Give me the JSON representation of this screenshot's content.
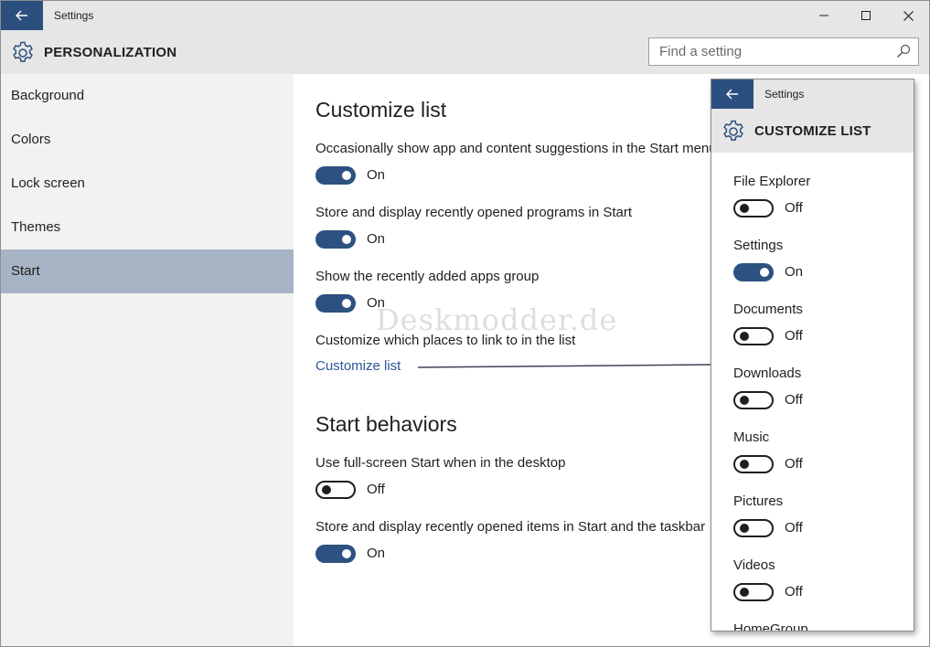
{
  "window": {
    "title": "Settings"
  },
  "header": {
    "title": "PERSONALIZATION",
    "search_placeholder": "Find a setting"
  },
  "sidebar": {
    "items": [
      {
        "label": "Background"
      },
      {
        "label": "Colors"
      },
      {
        "label": "Lock screen"
      },
      {
        "label": "Themes"
      },
      {
        "label": "Start",
        "selected": true
      }
    ]
  },
  "main": {
    "customize_list": {
      "title": "Customize list",
      "settings": [
        {
          "label": "Occasionally show app and content suggestions in the Start menu",
          "state": "On",
          "on": true
        },
        {
          "label": "Store and display recently opened programs in Start",
          "state": "On",
          "on": true
        },
        {
          "label": "Show the recently added apps group",
          "state": "On",
          "on": true
        }
      ],
      "places_label": "Customize which places to link to in the list",
      "link": "Customize list"
    },
    "start_behaviors": {
      "title": "Start behaviors",
      "settings": [
        {
          "label": "Use full-screen Start when in the desktop",
          "state": "Off",
          "on": false
        },
        {
          "label": "Store and display recently opened items in Start and the taskbar",
          "state": "On",
          "on": true
        }
      ]
    },
    "watermark": "Deskmodder.de"
  },
  "popup": {
    "window_title": "Settings",
    "header_title": "CUSTOMIZE LIST",
    "items": [
      {
        "label": "File Explorer",
        "state": "Off",
        "on": false
      },
      {
        "label": "Settings",
        "state": "On",
        "on": true
      },
      {
        "label": "Documents",
        "state": "Off",
        "on": false
      },
      {
        "label": "Downloads",
        "state": "Off",
        "on": false
      },
      {
        "label": "Music",
        "state": "Off",
        "on": false
      },
      {
        "label": "Pictures",
        "state": "Off",
        "on": false
      },
      {
        "label": "Videos",
        "state": "Off",
        "on": false
      },
      {
        "label": "HomeGroup"
      }
    ]
  },
  "colors": {
    "accent": "#2b4f7e",
    "toggle_on": "#2d5180",
    "selected_nav": "#a6b3c4",
    "link": "#2b5797"
  },
  "icons": [
    "back-arrow-icon",
    "minimize-icon",
    "maximize-icon",
    "close-icon",
    "gear-icon",
    "search-icon"
  ]
}
